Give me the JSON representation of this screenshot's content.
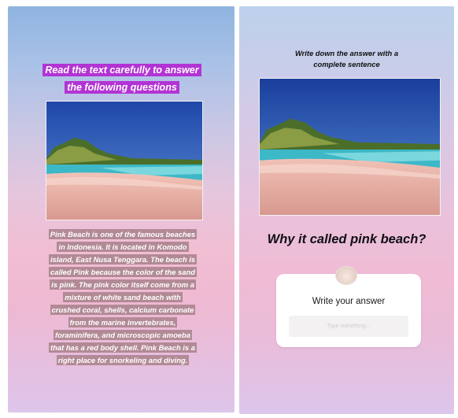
{
  "left_story": {
    "heading_lines": [
      "Read the text carefully to answer",
      "the following questions"
    ],
    "paragraph_lines": [
      "Pink Beach is one of the famous beaches",
      "in Indonesia. It is located in Komodo",
      "island, East Nusa Tenggara. The beach is",
      "called Pink because the color of the sand",
      "is pink. The pink color itself come from a",
      "mixture of white sand beach with",
      "crushed coral, shells, calcium carbonate",
      "from the marine invertebrates,",
      "foraminifera, and microscopic amoeba",
      "that has a red body shell. Pink Beach is a",
      "right place for snorkeling and diving."
    ]
  },
  "right_story": {
    "instruction_lines": [
      "Write down the answer with a",
      "complete sentence"
    ],
    "question": "Why it called pink beach?",
    "answer_box": {
      "prompt": "Write your answer",
      "placeholder": "Type something..."
    }
  },
  "colors": {
    "heading_highlight": "#b234d4",
    "paragraph_highlight": "#b28a96",
    "sky_top": "#8fb4e0",
    "pink_bottom": "#eeb9d2"
  }
}
